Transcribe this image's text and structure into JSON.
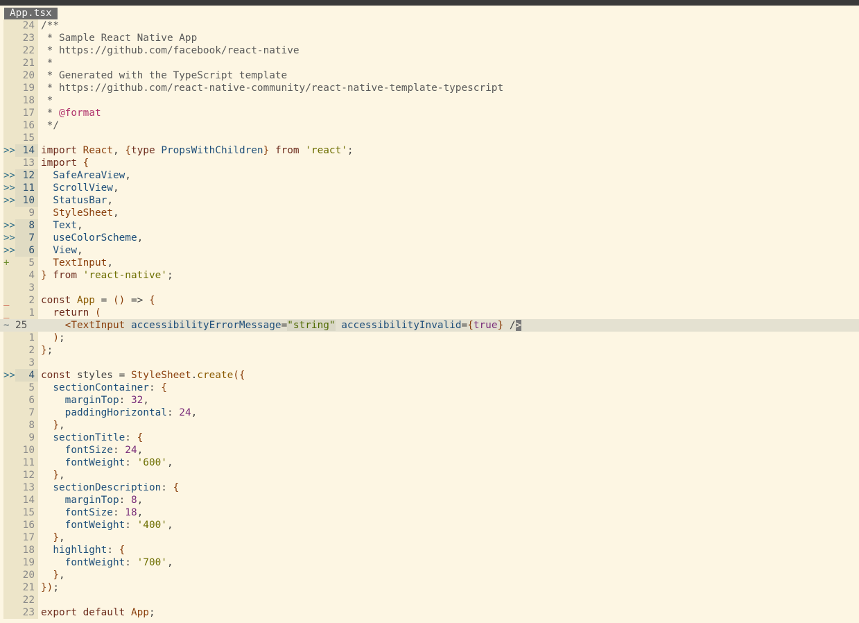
{
  "window": {
    "tab_title": "App.tsx"
  },
  "editor": {
    "lines": [
      {
        "sign": "",
        "num": "24",
        "segs": [
          [
            "c",
            "/**"
          ]
        ]
      },
      {
        "sign": "",
        "num": "23",
        "segs": [
          [
            "c",
            " * Sample React Native App"
          ]
        ]
      },
      {
        "sign": "",
        "num": "22",
        "segs": [
          [
            "c",
            " * https://github.com/facebook/react-native"
          ]
        ]
      },
      {
        "sign": "",
        "num": "21",
        "segs": [
          [
            "c",
            " *"
          ]
        ]
      },
      {
        "sign": "",
        "num": "20",
        "segs": [
          [
            "c",
            " * Generated with the TypeScript template"
          ]
        ]
      },
      {
        "sign": "",
        "num": "19",
        "segs": [
          [
            "c",
            " * https://github.com/react-native-community/react-native-template-typescript"
          ]
        ]
      },
      {
        "sign": "",
        "num": "18",
        "segs": [
          [
            "c",
            " *"
          ]
        ]
      },
      {
        "sign": "",
        "num": "17",
        "segs": [
          [
            "c",
            " * "
          ],
          [
            "decor",
            "@format"
          ]
        ]
      },
      {
        "sign": "",
        "num": "16",
        "segs": [
          [
            "c",
            " */"
          ]
        ]
      },
      {
        "sign": "",
        "num": "15",
        "segs": []
      },
      {
        "sign": ">>",
        "num": "14",
        "hl": true,
        "segs": [
          [
            "kw",
            "import "
          ],
          [
            "k",
            "React"
          ],
          [
            "pl",
            ", "
          ],
          [
            "p",
            "{"
          ],
          [
            "kw",
            "type "
          ],
          [
            "t",
            "PropsWithChildren"
          ],
          [
            "p",
            "}"
          ],
          [
            "kw",
            " from "
          ],
          [
            "s",
            "'react'"
          ],
          [
            "pl",
            ";"
          ]
        ]
      },
      {
        "sign": "",
        "num": "13",
        "segs": [
          [
            "kw",
            "import "
          ],
          [
            "p",
            "{"
          ]
        ]
      },
      {
        "sign": ">>",
        "num": "12",
        "hl": true,
        "segs": [
          [
            "pl",
            "  "
          ],
          [
            "t",
            "SafeAreaView"
          ],
          [
            "pl",
            ","
          ]
        ]
      },
      {
        "sign": ">>",
        "num": "11",
        "hl": true,
        "segs": [
          [
            "pl",
            "  "
          ],
          [
            "t",
            "ScrollView"
          ],
          [
            "pl",
            ","
          ]
        ]
      },
      {
        "sign": ">>",
        "num": "10",
        "hl": true,
        "segs": [
          [
            "pl",
            "  "
          ],
          [
            "t",
            "StatusBar"
          ],
          [
            "pl",
            ","
          ]
        ]
      },
      {
        "sign": "",
        "num": "9",
        "segs": [
          [
            "pl",
            "  "
          ],
          [
            "k",
            "StyleSheet"
          ],
          [
            "pl",
            ","
          ]
        ]
      },
      {
        "sign": ">>",
        "num": "8",
        "hl": true,
        "segs": [
          [
            "pl",
            "  "
          ],
          [
            "t",
            "Text"
          ],
          [
            "pl",
            ","
          ]
        ]
      },
      {
        "sign": ">>",
        "num": "7",
        "hl": true,
        "segs": [
          [
            "pl",
            "  "
          ],
          [
            "t",
            "useColorScheme"
          ],
          [
            "pl",
            ","
          ]
        ]
      },
      {
        "sign": ">>",
        "num": "6",
        "hl": true,
        "segs": [
          [
            "pl",
            "  "
          ],
          [
            "t",
            "View"
          ],
          [
            "pl",
            ","
          ]
        ]
      },
      {
        "sign": "+",
        "num": "5",
        "segs": [
          [
            "pl",
            "  "
          ],
          [
            "k",
            "TextInput"
          ],
          [
            "pl",
            ","
          ]
        ]
      },
      {
        "sign": "",
        "num": "4",
        "segs": [
          [
            "p",
            "}"
          ],
          [
            "kw",
            " from "
          ],
          [
            "s",
            "'react-native'"
          ],
          [
            "pl",
            ";"
          ]
        ]
      },
      {
        "sign": "",
        "num": "3",
        "segs": []
      },
      {
        "sign": "_",
        "num": "2",
        "segs": [
          [
            "kw",
            "const "
          ],
          [
            "f",
            "App"
          ],
          [
            "pl",
            " = "
          ],
          [
            "p",
            "()"
          ],
          [
            "pl",
            " => "
          ],
          [
            "p",
            "{"
          ]
        ]
      },
      {
        "sign": "_",
        "num": "1",
        "segs": [
          [
            "pl",
            "  "
          ],
          [
            "kw",
            "return "
          ],
          [
            "p",
            "("
          ]
        ]
      },
      {
        "sign": "~",
        "num": "25",
        "cur": true,
        "segs": [
          [
            "pl",
            "    "
          ],
          [
            "k",
            "<TextInput "
          ],
          [
            "prop",
            "accessibilityErrorMessage"
          ],
          [
            "pl",
            "="
          ],
          [
            "strbg",
            "\"string\""
          ],
          [
            "pl",
            " "
          ],
          [
            "prop",
            "accessibilityInvalid"
          ],
          [
            "pl",
            "="
          ],
          [
            "p",
            "{"
          ],
          [
            "bool",
            "true"
          ],
          [
            "p",
            "}"
          ],
          [
            "pl",
            " /"
          ],
          [
            "cursor",
            ">"
          ]
        ]
      },
      {
        "sign": "",
        "num": "1",
        "segs": [
          [
            "pl",
            "  "
          ],
          [
            "p",
            ")"
          ],
          [
            "pl",
            ";"
          ]
        ]
      },
      {
        "sign": "",
        "num": "2",
        "segs": [
          [
            "p",
            "}"
          ],
          [
            "pl",
            ";"
          ]
        ]
      },
      {
        "sign": "",
        "num": "3",
        "segs": []
      },
      {
        "sign": ">>",
        "num": "4",
        "hl": true,
        "segs": [
          [
            "kw",
            "const "
          ],
          [
            "pl",
            "styles = "
          ],
          [
            "k",
            "StyleSheet"
          ],
          [
            "pl",
            "."
          ],
          [
            "f",
            "create"
          ],
          [
            "p",
            "({"
          ]
        ]
      },
      {
        "sign": "",
        "num": "5",
        "segs": [
          [
            "pl",
            "  "
          ],
          [
            "prop",
            "sectionContainer"
          ],
          [
            "pl",
            ": "
          ],
          [
            "p",
            "{"
          ]
        ]
      },
      {
        "sign": "",
        "num": "6",
        "segs": [
          [
            "pl",
            "    "
          ],
          [
            "prop",
            "marginTop"
          ],
          [
            "pl",
            ": "
          ],
          [
            "n",
            "32"
          ],
          [
            "pl",
            ","
          ]
        ]
      },
      {
        "sign": "",
        "num": "7",
        "segs": [
          [
            "pl",
            "    "
          ],
          [
            "prop",
            "paddingHorizontal"
          ],
          [
            "pl",
            ": "
          ],
          [
            "n",
            "24"
          ],
          [
            "pl",
            ","
          ]
        ]
      },
      {
        "sign": "",
        "num": "8",
        "segs": [
          [
            "pl",
            "  "
          ],
          [
            "p",
            "}"
          ],
          [
            "pl",
            ","
          ]
        ]
      },
      {
        "sign": "",
        "num": "9",
        "segs": [
          [
            "pl",
            "  "
          ],
          [
            "prop",
            "sectionTitle"
          ],
          [
            "pl",
            ": "
          ],
          [
            "p",
            "{"
          ]
        ]
      },
      {
        "sign": "",
        "num": "10",
        "segs": [
          [
            "pl",
            "    "
          ],
          [
            "prop",
            "fontSize"
          ],
          [
            "pl",
            ": "
          ],
          [
            "n",
            "24"
          ],
          [
            "pl",
            ","
          ]
        ]
      },
      {
        "sign": "",
        "num": "11",
        "segs": [
          [
            "pl",
            "    "
          ],
          [
            "prop",
            "fontWeight"
          ],
          [
            "pl",
            ": "
          ],
          [
            "s",
            "'600'"
          ],
          [
            "pl",
            ","
          ]
        ]
      },
      {
        "sign": "",
        "num": "12",
        "segs": [
          [
            "pl",
            "  "
          ],
          [
            "p",
            "}"
          ],
          [
            "pl",
            ","
          ]
        ]
      },
      {
        "sign": "",
        "num": "13",
        "segs": [
          [
            "pl",
            "  "
          ],
          [
            "prop",
            "sectionDescription"
          ],
          [
            "pl",
            ": "
          ],
          [
            "p",
            "{"
          ]
        ]
      },
      {
        "sign": "",
        "num": "14",
        "segs": [
          [
            "pl",
            "    "
          ],
          [
            "prop",
            "marginTop"
          ],
          [
            "pl",
            ": "
          ],
          [
            "n",
            "8"
          ],
          [
            "pl",
            ","
          ]
        ]
      },
      {
        "sign": "",
        "num": "15",
        "segs": [
          [
            "pl",
            "    "
          ],
          [
            "prop",
            "fontSize"
          ],
          [
            "pl",
            ": "
          ],
          [
            "n",
            "18"
          ],
          [
            "pl",
            ","
          ]
        ]
      },
      {
        "sign": "",
        "num": "16",
        "segs": [
          [
            "pl",
            "    "
          ],
          [
            "prop",
            "fontWeight"
          ],
          [
            "pl",
            ": "
          ],
          [
            "s",
            "'400'"
          ],
          [
            "pl",
            ","
          ]
        ]
      },
      {
        "sign": "",
        "num": "17",
        "segs": [
          [
            "pl",
            "  "
          ],
          [
            "p",
            "}"
          ],
          [
            "pl",
            ","
          ]
        ]
      },
      {
        "sign": "",
        "num": "18",
        "segs": [
          [
            "pl",
            "  "
          ],
          [
            "prop",
            "highlight"
          ],
          [
            "pl",
            ": "
          ],
          [
            "p",
            "{"
          ]
        ]
      },
      {
        "sign": "",
        "num": "19",
        "segs": [
          [
            "pl",
            "    "
          ],
          [
            "prop",
            "fontWeight"
          ],
          [
            "pl",
            ": "
          ],
          [
            "s",
            "'700'"
          ],
          [
            "pl",
            ","
          ]
        ]
      },
      {
        "sign": "",
        "num": "20",
        "segs": [
          [
            "pl",
            "  "
          ],
          [
            "p",
            "}"
          ],
          [
            "pl",
            ","
          ]
        ]
      },
      {
        "sign": "",
        "num": "21",
        "segs": [
          [
            "p",
            "})"
          ],
          [
            "pl",
            ";"
          ]
        ]
      },
      {
        "sign": "",
        "num": "22",
        "segs": []
      },
      {
        "sign": "",
        "num": "23",
        "segs": [
          [
            "kw",
            "export default "
          ],
          [
            "k",
            "App"
          ],
          [
            "pl",
            ";"
          ]
        ]
      }
    ]
  }
}
